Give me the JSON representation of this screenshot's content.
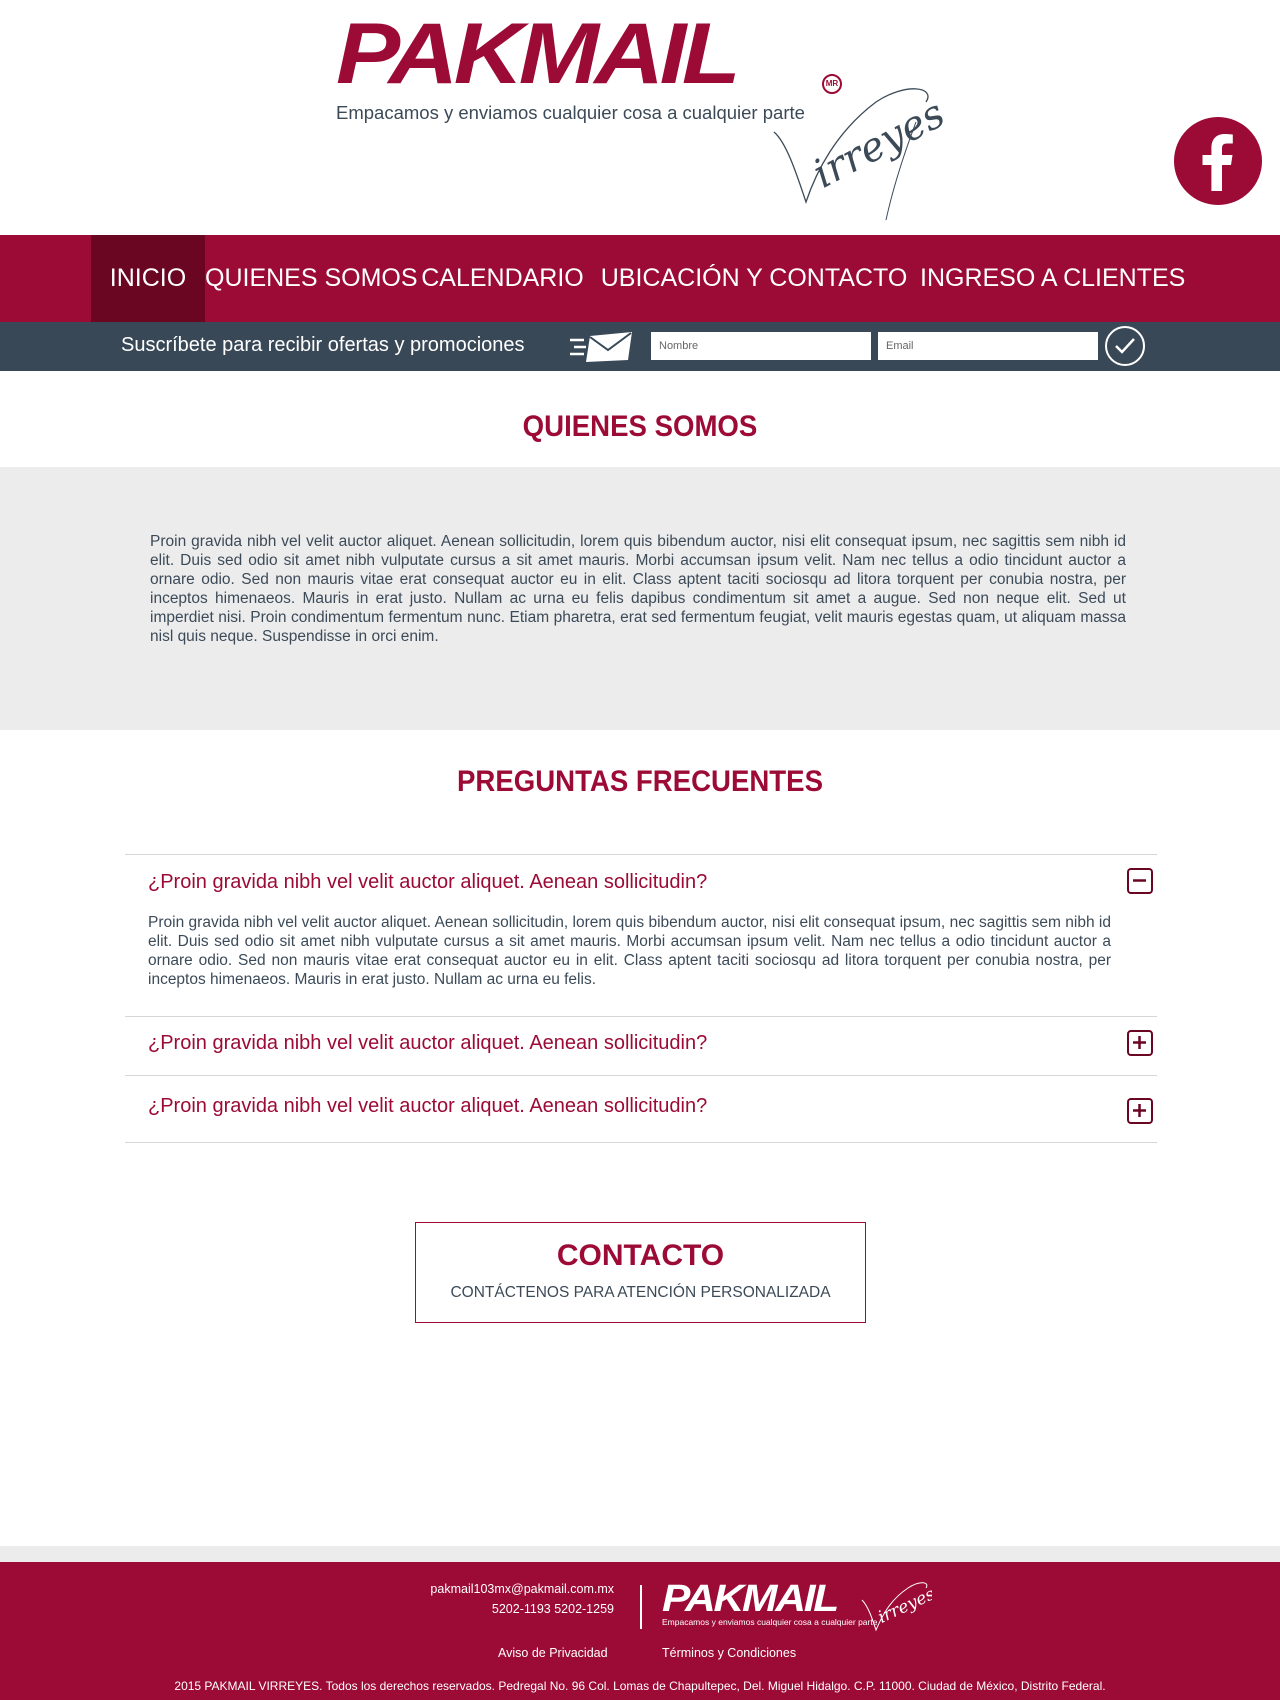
{
  "brand": {
    "logo_word": "PAKMAIL",
    "logo_mark": "MR",
    "tagline": "Empacamos y enviamos cualquier cosa a cualquier parte",
    "script": "Virreyes",
    "facebook_icon": "facebook-icon",
    "primary_color": "#9c0a36",
    "dark_color": "#394857"
  },
  "nav": {
    "items": [
      {
        "label": "INICIO",
        "active": true
      },
      {
        "label": "QUIENES SOMOS"
      },
      {
        "label": "CALENDARIO"
      },
      {
        "label": "UBICACIÓN Y CONTACTO"
      },
      {
        "label": "INGRESO A CLIENTES"
      }
    ]
  },
  "subscribe": {
    "text": "Suscríbete para recibir ofertas y promociones",
    "icon": "envelope-icon",
    "name_placeholder": "Nombre",
    "email_placeholder": "Email",
    "submit_icon": "check-icon"
  },
  "about": {
    "title": "QUIENES SOMOS",
    "body": "Proin gravida nibh vel velit auctor aliquet. Aenean sollicitudin, lorem quis bibendum auctor, nisi elit consequat ipsum, nec sagittis sem nibh id elit. Duis sed odio sit amet nibh vulputate cursus a sit amet mauris. Morbi accumsan ipsum velit. Nam nec tellus a odio tincidunt auctor a ornare odio. Sed non  mauris vitae erat consequat auctor eu in elit. Class aptent taciti sociosqu ad litora torquent per conubia nostra, per inceptos himenaeos. Mauris in erat justo. Nullam ac urna eu felis dapibus condimentum sit amet a augue. Sed non neque elit. Sed ut imperdiet nisi. Proin condimentum fermentum nunc. Etiam pharetra, erat sed fermentum feugiat, velit mauris egestas quam, ut aliquam massa nisl quis neque. Suspendisse in orci enim."
  },
  "faq": {
    "title": "PREGUNTAS FRECUENTES",
    "items": [
      {
        "question": "¿Proin gravida nibh vel velit auctor aliquet. Aenean sollicitudin?",
        "answer": "Proin gravida nibh vel velit auctor aliquet. Aenean sollicitudin, lorem quis bibendum auctor, nisi elit consequat ipsum, nec sagittis sem nibh id elit. Duis sed odio sit amet nibh vulputate cursus a sit amet mauris. Morbi accumsan ipsum velit. Nam nec tellus a odio tincidunt auctor a ornare odio. Sed non  mauris vitae erat consequat auctor eu in elit. Class aptent taciti sociosqu ad litora torquent per conubia nostra, per inceptos himenaeos. Mauris in erat justo. Nullam ac urna eu felis.",
        "expanded": true,
        "toggle_icon": "minus-square-icon"
      },
      {
        "question": "¿Proin gravida nibh vel velit auctor aliquet. Aenean sollicitudin?",
        "expanded": false,
        "toggle_icon": "plus-square-icon"
      },
      {
        "question": "¿Proin gravida nibh vel velit auctor aliquet. Aenean sollicitudin?",
        "expanded": false,
        "toggle_icon": "plus-square-icon"
      }
    ]
  },
  "contact": {
    "title": "CONTACTO",
    "subtitle": "CONTÁCTENOS PARA ATENCIÓN PERSONALIZADA"
  },
  "footer": {
    "email": "pakmail103mx@pakmail.com.mx",
    "phones": "5202-1193   5202-1259",
    "logo_word": "PAKMAIL",
    "tagline": "Empacamos y enviamos cualquier cosa a cualquier parte",
    "script": "Virreyes",
    "privacy": "Aviso de Privacidad",
    "terms": "Términos y Condiciones",
    "copyright": "2015 PAKMAIL VIRREYES. Todos los derechos reservados. Pedregal No. 96 Col. Lomas de Chapultepec, Del. Miguel Hidalgo. C.P. 11000. Ciudad de México, Distrito Federal."
  }
}
